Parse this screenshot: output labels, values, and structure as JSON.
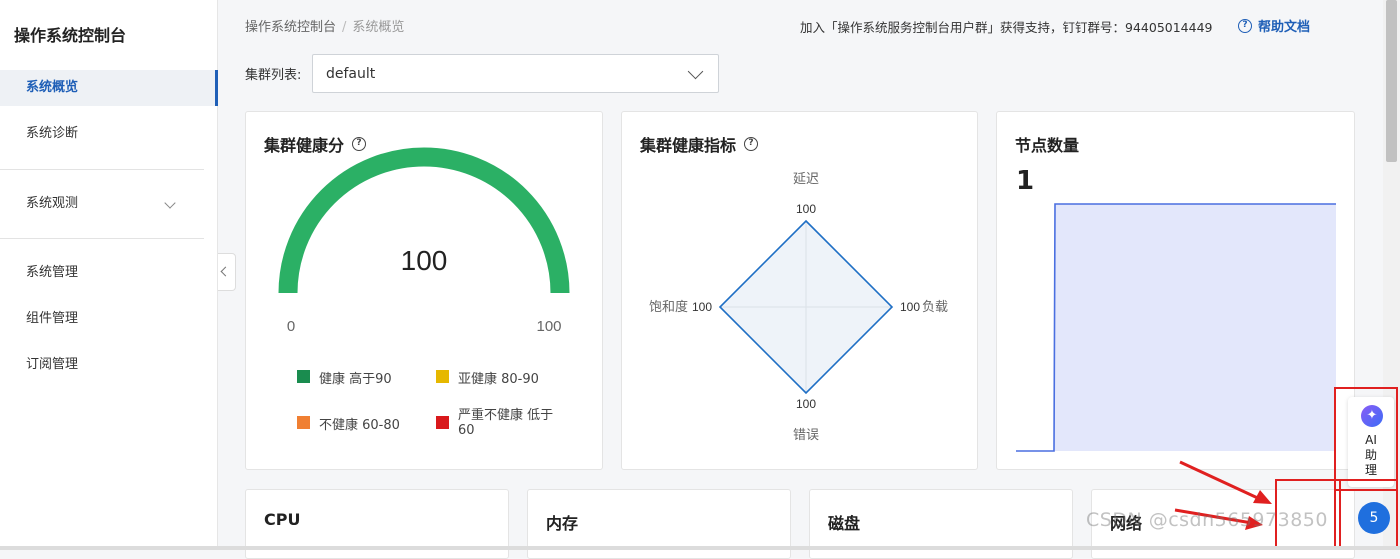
{
  "sidebar": {
    "title": "操作系统控制台",
    "items": [
      "系统概览",
      "系统诊断",
      "系统观测",
      "系统管理",
      "组件管理",
      "订阅管理"
    ]
  },
  "breadcrumb": {
    "root": "操作系统控制台",
    "current": "系统概览"
  },
  "header": {
    "join_text": "加入「操作系统服务控制台用户群」获得支持，钉钉群号：94405014449",
    "help_label": "帮助文档",
    "help_icon": "question-icon"
  },
  "cluster_select": {
    "label": "集群列表:",
    "value": "default"
  },
  "health_score": {
    "title": "集群健康分",
    "value": "100",
    "min_label": "0",
    "max_label": "100",
    "gauge_fraction": 1.0,
    "gauge_color": "#2bb065",
    "legend": [
      {
        "label": "健康 高于90",
        "color": "#1a8c4f"
      },
      {
        "label": "亚健康 80-90",
        "color": "#e6b800"
      },
      {
        "label": "不健康 60-80",
        "color": "#f07f32"
      },
      {
        "label": "严重不健康 低于60",
        "color": "#d9191c"
      }
    ]
  },
  "health_metrics": {
    "title": "集群健康指标",
    "axes": [
      {
        "name": "延迟",
        "value": "100"
      },
      {
        "name": "负载",
        "value": "100"
      },
      {
        "name": "错误",
        "value": "100"
      },
      {
        "name": "饱和度",
        "value": "100"
      }
    ],
    "line_color": "#1f6fc5"
  },
  "node_count": {
    "title": "节点数量",
    "value": "1",
    "series_color": "#4a6fe0",
    "fill_color": "#e3e7fb"
  },
  "bottom_cards": [
    "CPU",
    "内存",
    "磁盘",
    "网络"
  ],
  "ai_assistant": {
    "line1": "AI",
    "line2": "助",
    "line3": "理"
  },
  "watermark": "CSDN @csdn565973850",
  "chart_data": [
    {
      "type": "gauge",
      "title": "集群健康分",
      "value": 100,
      "range": [
        0,
        100
      ]
    },
    {
      "type": "radar",
      "title": "集群健康指标",
      "categories": [
        "延迟",
        "负载",
        "错误",
        "饱和度"
      ],
      "values": [
        100,
        100,
        100,
        100
      ],
      "range": [
        0,
        100
      ]
    },
    {
      "type": "area",
      "title": "节点数量",
      "series": [
        {
          "values": [
            0,
            1,
            1
          ]
        }
      ]
    }
  ]
}
